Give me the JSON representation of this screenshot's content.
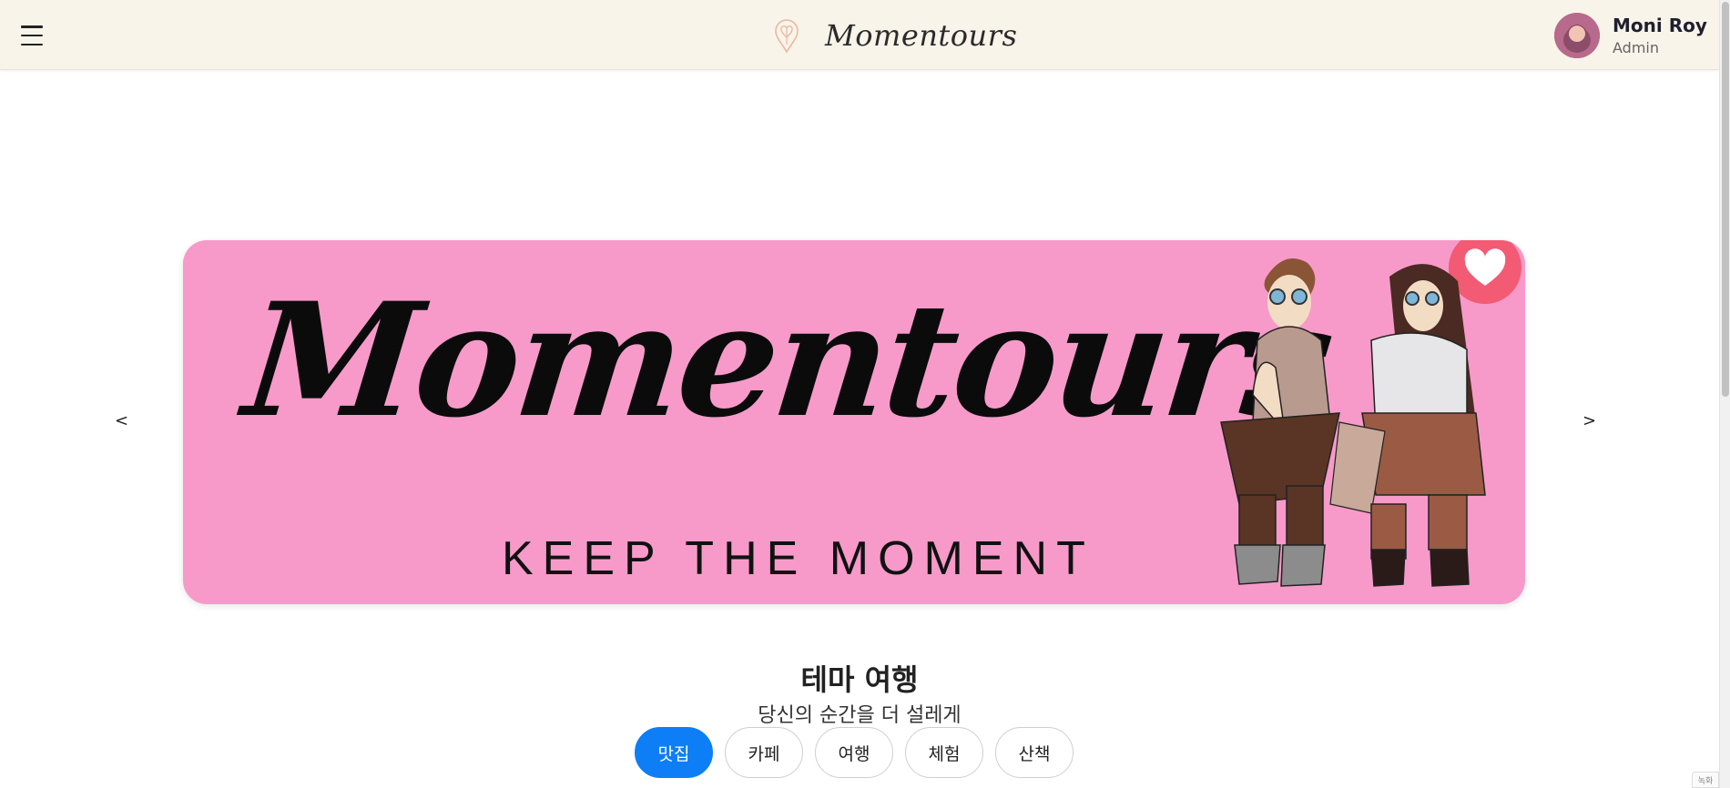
{
  "header": {
    "menu_icon": "hamburger-menu-icon",
    "brand_icon": "map-pin-heart-icon",
    "brand_name": "Momentours",
    "user": {
      "name": "Moni Roy",
      "role": "Admin"
    }
  },
  "carousel": {
    "prev_label": "<",
    "next_label": ">",
    "banner": {
      "title": "Momentours",
      "tagline": "KEEP THE MOMENT",
      "background_color": "#f79ac9",
      "heart_color": "#f35a74"
    }
  },
  "theme_section": {
    "title": "테마 여행",
    "subtitle": "당신의 순간을 더 설레게",
    "chips": [
      {
        "label": "맛집",
        "active": true
      },
      {
        "label": "카페",
        "active": false
      },
      {
        "label": "여행",
        "active": false
      },
      {
        "label": "체험",
        "active": false
      },
      {
        "label": "산책",
        "active": false
      }
    ],
    "accent_color": "#0d7ef6"
  },
  "corner_badge": "녹화"
}
